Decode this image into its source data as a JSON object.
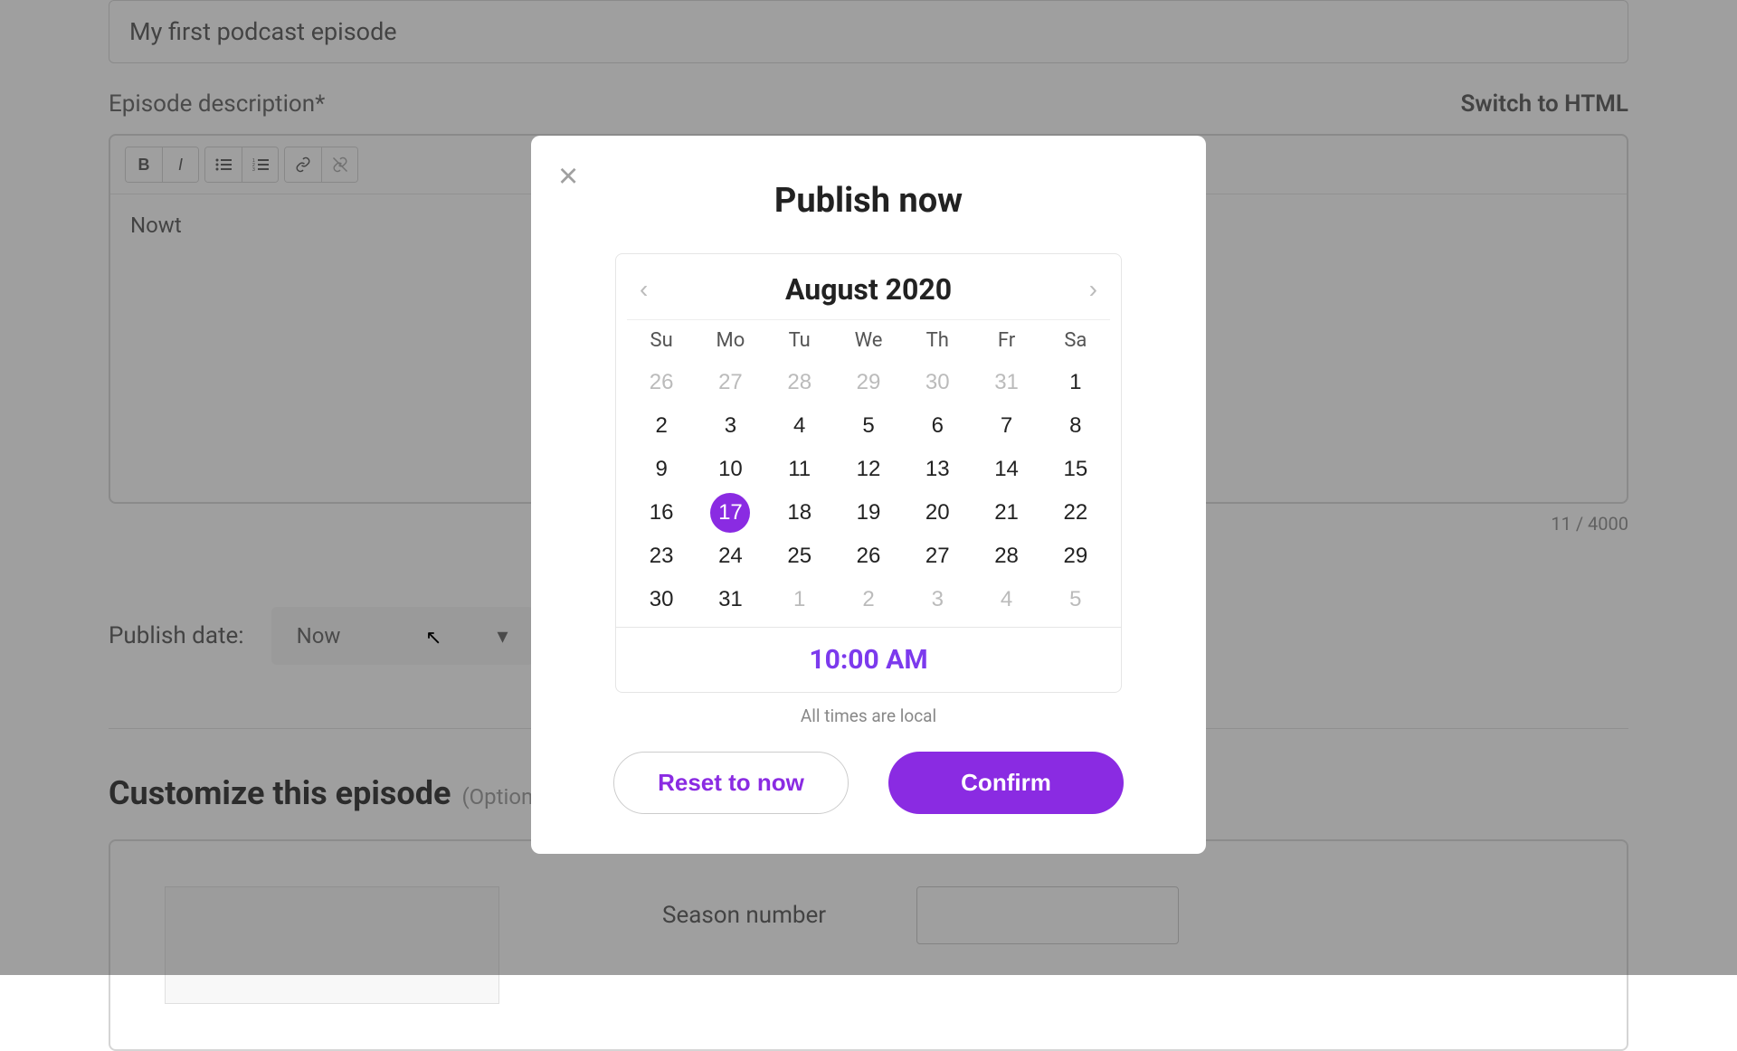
{
  "episode_title": "My first podcast episode",
  "description_label": "Episode description*",
  "switch_html_label": "Switch to HTML",
  "description_text": "Nowt",
  "char_count": "11 / 4000",
  "publish_date_label": "Publish date:",
  "publish_date_value": "Now",
  "customize_heading": "Customize this episode",
  "optional_label": "(Optional)",
  "season_label": "Season number",
  "cursor_glyph": "↖",
  "modal": {
    "title": "Publish now",
    "month_label": "August 2020",
    "dow": [
      "Su",
      "Mo",
      "Tu",
      "We",
      "Th",
      "Fr",
      "Sa"
    ],
    "weeks": [
      [
        {
          "n": "26",
          "muted": true
        },
        {
          "n": "27",
          "muted": true
        },
        {
          "n": "28",
          "muted": true
        },
        {
          "n": "29",
          "muted": true
        },
        {
          "n": "30",
          "muted": true
        },
        {
          "n": "31",
          "muted": true
        },
        {
          "n": "1"
        }
      ],
      [
        {
          "n": "2"
        },
        {
          "n": "3"
        },
        {
          "n": "4"
        },
        {
          "n": "5"
        },
        {
          "n": "6"
        },
        {
          "n": "7"
        },
        {
          "n": "8"
        }
      ],
      [
        {
          "n": "9"
        },
        {
          "n": "10"
        },
        {
          "n": "11"
        },
        {
          "n": "12"
        },
        {
          "n": "13"
        },
        {
          "n": "14"
        },
        {
          "n": "15"
        }
      ],
      [
        {
          "n": "16"
        },
        {
          "n": "17",
          "selected": true
        },
        {
          "n": "18"
        },
        {
          "n": "19"
        },
        {
          "n": "20"
        },
        {
          "n": "21"
        },
        {
          "n": "22"
        }
      ],
      [
        {
          "n": "23"
        },
        {
          "n": "24"
        },
        {
          "n": "25"
        },
        {
          "n": "26"
        },
        {
          "n": "27"
        },
        {
          "n": "28"
        },
        {
          "n": "29"
        }
      ],
      [
        {
          "n": "30"
        },
        {
          "n": "31"
        },
        {
          "n": "1",
          "muted": true
        },
        {
          "n": "2",
          "muted": true
        },
        {
          "n": "3",
          "muted": true
        },
        {
          "n": "4",
          "muted": true
        },
        {
          "n": "5",
          "muted": true
        }
      ]
    ],
    "time": "10:00 AM",
    "tz_note": "All times are local",
    "reset_label": "Reset to now",
    "confirm_label": "Confirm"
  }
}
